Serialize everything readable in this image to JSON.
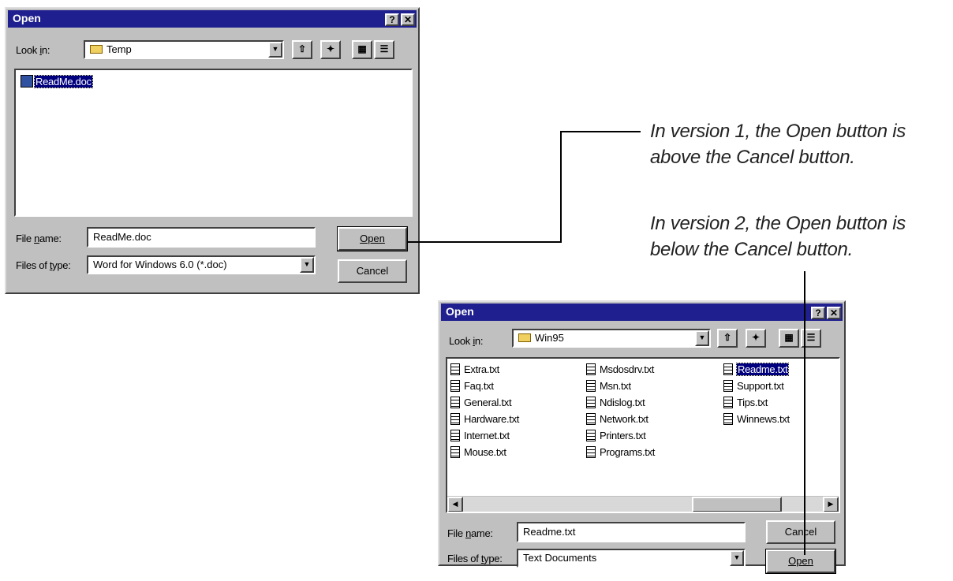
{
  "dialog1": {
    "title": "Open",
    "help_btn": "?",
    "close_btn": "✕",
    "look_in_label": "Look in:",
    "look_in_value": "Temp",
    "files": [
      {
        "name": "ReadMe.doc",
        "selected": true
      }
    ],
    "filename_label": "File name:",
    "filename_value": "ReadMe.doc",
    "filetype_label": "Files of type:",
    "filetype_value": "Word for Windows 6.0 (*.doc)",
    "open_label": "Open",
    "cancel_label": "Cancel"
  },
  "dialog2": {
    "title": "Open",
    "help_btn": "?",
    "close_btn": "✕",
    "look_in_label": "Look in:",
    "look_in_value": "Win95",
    "files": [
      {
        "name": "Extra.txt"
      },
      {
        "name": "Faq.txt"
      },
      {
        "name": "General.txt"
      },
      {
        "name": "Hardware.txt"
      },
      {
        "name": "Internet.txt"
      },
      {
        "name": "Mouse.txt"
      },
      {
        "name": "Msdosdrv.txt"
      },
      {
        "name": "Msn.txt"
      },
      {
        "name": "Ndislog.txt"
      },
      {
        "name": "Network.txt"
      },
      {
        "name": "Printers.txt"
      },
      {
        "name": "Programs.txt"
      },
      {
        "name": "Readme.txt",
        "selected": true
      },
      {
        "name": "Support.txt"
      },
      {
        "name": "Tips.txt"
      },
      {
        "name": "Winnews.txt"
      }
    ],
    "filename_label": "File name:",
    "filename_value": "Readme.txt",
    "filetype_label": "Files of type:",
    "filetype_value": "Text Documents",
    "cancel_label": "Cancel",
    "open_label": "Open"
  },
  "captions": {
    "version1_line1": "In version 1, the Open button is",
    "version1_line2": "above the Cancel button.",
    "version2_line1": "In version 2, the Open button is",
    "version2_line2": "below the Cancel button."
  },
  "icons": [
    "help-icon",
    "close-icon",
    "folder-icon",
    "up-one-level-icon",
    "new-folder-icon",
    "list-view-icon",
    "details-view-icon",
    "text-document-icon",
    "word-document-icon",
    "chevron-down-icon",
    "arrow-left-icon",
    "arrow-right-icon"
  ]
}
